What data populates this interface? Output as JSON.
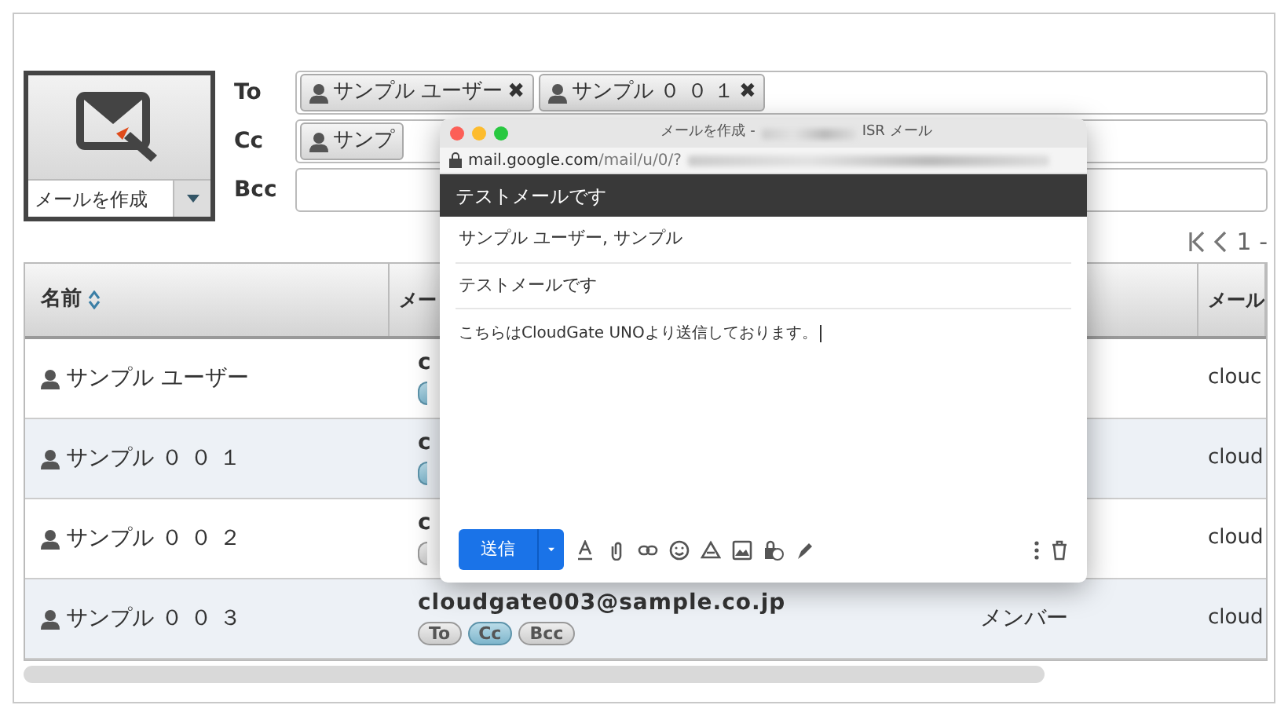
{
  "compose_tile": {
    "label": "メールを作成"
  },
  "recipients": [
    {
      "label": "To",
      "chips": [
        {
          "name": "サンプル ユーザー",
          "remove": "✖"
        },
        {
          "name": "サンプル ０ ０ １",
          "remove": "✖"
        }
      ]
    },
    {
      "label": "Cc",
      "chips": [
        {
          "name": "サンプ"
        }
      ]
    },
    {
      "label": "Bcc"
    }
  ],
  "pager": {
    "range": "1 -"
  },
  "table": {
    "columns": [
      {
        "label": "名前",
        "sortable": true
      },
      {
        "label": "メー"
      },
      {
        "label": "メール"
      }
    ],
    "rows": [
      {
        "name": "サンプル ユーザー",
        "email": "c",
        "tags": [
          {
            "selected": true
          }
        ],
        "column_4": "clouc"
      },
      {
        "name": "サンプル ０ ０ １",
        "email": "c",
        "tags": [
          {
            "selected": true
          }
        ],
        "column_4": "cloud"
      },
      {
        "name": "サンプル ０ ０ ２",
        "email": "c",
        "tags": [
          {
            "selected": false
          }
        ],
        "column_4": "cloud"
      },
      {
        "name": "サンプル ０ ０ ３",
        "email": "cloudgate003@sample.co.jp",
        "tags": [
          {
            "label": "To",
            "selected": false
          },
          {
            "label": "Cc",
            "selected": true
          },
          {
            "label": "Bcc",
            "selected": false
          }
        ],
        "role": "メンバー",
        "column_4": "cloud"
      }
    ]
  },
  "compose_window": {
    "title": "メールを作成 -",
    "title_suffix": "ISR メール",
    "url_host": "mail.google.com",
    "url_path": "/mail/u/0/?",
    "header": "テストメールです",
    "to": "サンプル ユーザー, サンプル",
    "subject": "テストメールです",
    "body": "こちらはCloudGate UNOより送信しております。",
    "send": "送信"
  }
}
